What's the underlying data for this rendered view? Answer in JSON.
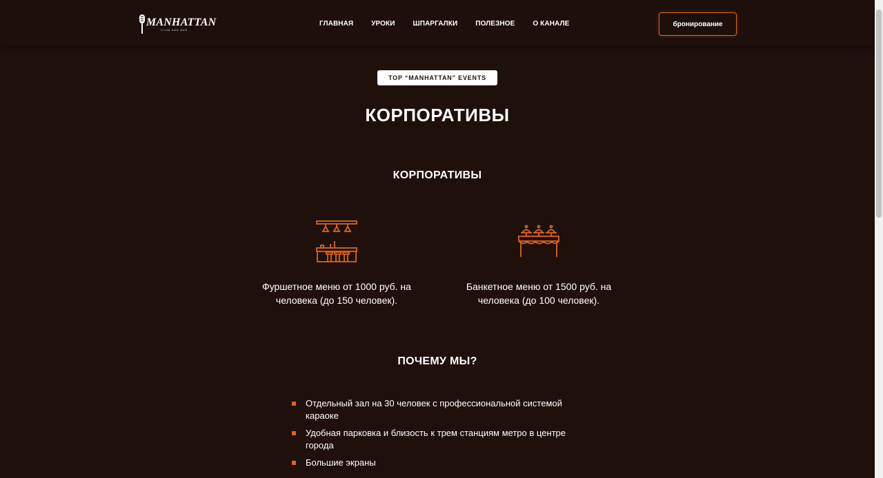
{
  "header": {
    "logo_text": "MANHATTAN",
    "logo_sub": "CLUB AND BAR",
    "nav": [
      "ГЛАВНАЯ",
      "УРОКИ",
      "ШПАРГАЛКИ",
      "ПОЛЕЗНОЕ",
      "О КАНАЛЕ"
    ],
    "book_button": "бронирование"
  },
  "main": {
    "tag": "TOP “MANHATTAN” EVENTS",
    "title": "КОРПОРАТИВЫ",
    "section_title": "КОРПОРАТИВЫ",
    "features": [
      {
        "icon": "bar-counter-icon",
        "text": "Фуршетное меню от 1000 руб. на человека (до 150 человек)."
      },
      {
        "icon": "banquet-table-icon",
        "text": "Банкетное меню от 1500 руб. на человека (до 100 человек)."
      }
    ],
    "why_title": "ПОЧЕМУ МЫ?",
    "reasons": [
      "Отдельный зал на 30 человек с профессиональной системой караоке",
      "Удобная парковка и близость к трем станциям метро в центре города",
      "Большие экраны"
    ]
  },
  "colors": {
    "background": "#1f100c",
    "accent": "#e0651f",
    "text": "#ffffff"
  }
}
